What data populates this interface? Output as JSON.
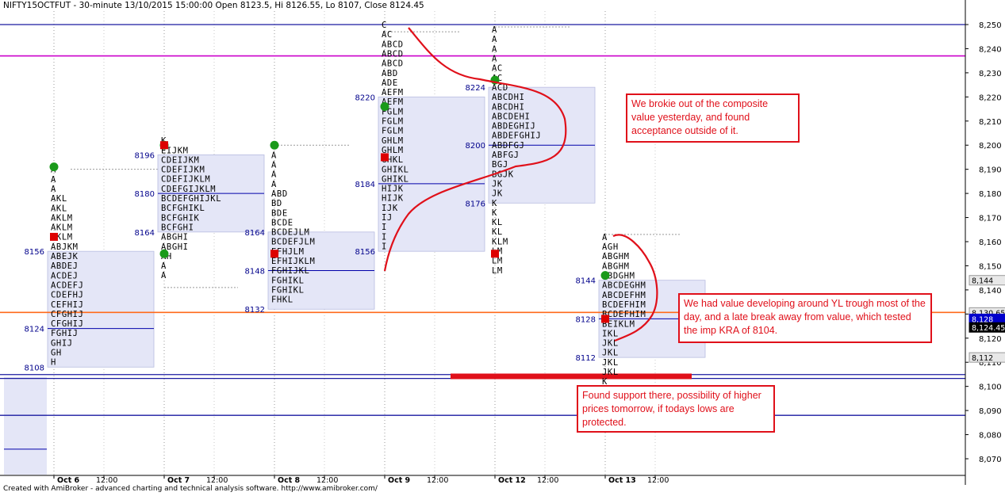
{
  "header": {
    "title": "NIFTY15OCTFUT - 30-minute 13/10/2015 15:00:00 Open 8123.5, Hi 8126.55, Lo 8107, Close 8124.45"
  },
  "footer": {
    "text": "Created with AmiBroker - advanced charting and technical analysis software. http://www.amibroker.com/"
  },
  "notes": [
    {
      "text": "We brokie out of the composite value yesterday, and found acceptance outside of it."
    },
    {
      "text": "We had value developing around YL trough most of the day, and a late break away from value, which tested the imp KRA of 8104."
    },
    {
      "text": "Found support there, possibility of higher prices tomorrow, if todays lows are protected."
    }
  ],
  "colors": {
    "value_area_fill": "#e4e6f7",
    "dark_blue": "#1a1aa0",
    "magenta": "#cc00cc",
    "orange": "#ff6a1a",
    "annotation_red": "#e0101a",
    "poc_blue": "#0000aa",
    "green_dot": "#1a9a1a",
    "red_square": "#dd0000",
    "price_label_text": "#00008b"
  },
  "chart_data": {
    "type": "market_profile",
    "title": "NIFTY15OCTFUT - 30-minute 13/10/2015 15:00:00 Open 8123.5, Hi 8126.55, Lo 8107, Close 8124.45",
    "ylim": [
      8062,
      8254
    ],
    "y_ticks": [
      8070,
      8080,
      8090,
      8100,
      8110,
      8120,
      8130,
      8140,
      8150,
      8160,
      8170,
      8180,
      8190,
      8200,
      8210,
      8220,
      8230,
      8240,
      8250
    ],
    "y_tick_labels": [
      "8,070",
      "8,080",
      "8,090",
      "8,100",
      "8,110",
      "8,120",
      "8,130",
      "8,140",
      "8,150",
      "8,160",
      "8,170",
      "8,180",
      "8,190",
      "8,200",
      "8,210",
      "8,220",
      "8,230",
      "8,240",
      "8,250"
    ],
    "x_labels": [
      "Oct 6",
      "12:00",
      "Oct 7",
      "12:00",
      "Oct 8",
      "12:00",
      "Oct 9",
      "12:00",
      "Oct 12",
      "12:00",
      "Oct 13",
      "12:00"
    ],
    "horizontal_lines": [
      {
        "price": 8250,
        "color": "dark_blue"
      },
      {
        "price": 8237,
        "color": "magenta"
      },
      {
        "price": 8130.65,
        "color": "orange"
      },
      {
        "price": 8104.9,
        "color": "dark_blue"
      },
      {
        "price": 8103.3,
        "color": "dark_blue"
      },
      {
        "price": 8088,
        "color": "dark_blue"
      }
    ],
    "axis_tags": [
      {
        "text": "8,144",
        "price": 8144,
        "style": "gray"
      },
      {
        "text": "8,130.65",
        "price": 8130.65,
        "style": "gray"
      },
      {
        "text": "8,128",
        "price": 8128,
        "style": "blue"
      },
      {
        "text": "8,124.45",
        "price": 8124.45,
        "style": "dark"
      },
      {
        "text": "8,112",
        "price": 8112,
        "style": "gray"
      }
    ],
    "kra_zone": {
      "from": "Oct 9",
      "to": "Oct 13",
      "price": 8104
    },
    "profiles": [
      {
        "day": "Oct 6",
        "top": 8190,
        "letters": [
          "A",
          "A",
          "A",
          "AKL",
          "AKL",
          "AKLM",
          "AKLM",
          "AKLM",
          "ABJKM",
          "ABEJK",
          "ABDEJ",
          "ACDEJ",
          "ACDEFJ",
          "CDEFHJ",
          "CEFHIJ",
          "CFGHIJ",
          "CFGHIJ",
          "FGHIJ",
          "GHIJ",
          "GH",
          "H"
        ],
        "vah": 8156,
        "poc": 8124,
        "val": 8108,
        "open_marker": "A",
        "close_marker": "M",
        "extra_box": [
          8104,
          8070
        ]
      },
      {
        "day": "Oct 7",
        "top": 8202,
        "letters": [
          "K",
          "EIJKM",
          "CDEIJKM",
          "CDEFIJKM",
          "CDEFIJKLM",
          "CDEFGIJKLM",
          "BCDEFGHIJKL",
          "BCFGHIKL",
          "BCFGHIK",
          "BCFGHI",
          "ABGHI",
          "ABGHI",
          "AH",
          "A",
          "A"
        ],
        "vah": 8196,
        "poc": 8180,
        "val": 8164,
        "open_marker": "A",
        "close_marker": "M"
      },
      {
        "day": "Oct 8",
        "top": 8200,
        "letters": [
          "A",
          "A",
          "A",
          "A",
          "A",
          "ABD",
          "BD",
          "BDE",
          "BCDE",
          "BCDEJLM",
          "BCDEFJLM",
          "EFHJLM",
          "EFHIJKLM",
          "FGHIJKL",
          "FGHIKL",
          "FGHIKL",
          "FHKL"
        ],
        "vah": 8164,
        "poc": 8148,
        "val": 8132,
        "open_marker": "A",
        "close_marker": "M"
      },
      {
        "day": "Oct 9",
        "top": 8250,
        "letters": [
          "C",
          "AC",
          "ABCD",
          "ABCD",
          "ABCD",
          "ABD",
          "ADE",
          "AEFM",
          "AEFM",
          "FGLM",
          "FGLM",
          "FGLM",
          "GHLM",
          "GHLM",
          "GHKL",
          "GHIKL",
          "GHIKL",
          "HIJK",
          "HIJK",
          "IJK",
          "IJ",
          "I",
          "I",
          "I"
        ],
        "vah": 8220,
        "poc": 8184,
        "val": 8156,
        "open_marker": "A",
        "close_marker": "M"
      },
      {
        "day": "Oct 12",
        "top": 8248,
        "letters": [
          "A",
          "A",
          "A",
          "A",
          "AC",
          "AC",
          "ACD",
          "ABCDHI",
          "ABCDHI",
          "ABCDEHI",
          "ABDEGHIJ",
          "ABDEFGHIJ",
          "ABDFGJ",
          "ABFGJ",
          "BGJ",
          "BGJK",
          "JK",
          "JK",
          "K",
          "K",
          "KL",
          "KL",
          "KLM",
          "LM",
          "LM",
          "LM"
        ],
        "vah": 8224,
        "poc": 8200,
        "val": 8176,
        "open_marker": "A",
        "close_marker": "M"
      },
      {
        "day": "Oct 13",
        "top": 8162,
        "letters": [
          "A",
          "AGH",
          "ABGHM",
          "ABGHM",
          "ABDGHM",
          "ABCDEGHM",
          "ABCDEFHM",
          "BCDEFHIM",
          "BCDEFHIM",
          "BEIKLM",
          "IKL",
          "JKL",
          "JKL",
          "JKL",
          "JKL",
          "K"
        ],
        "vah": 8144,
        "poc": 8128,
        "val": 8112,
        "open_marker": "A",
        "close_marker": "M"
      }
    ],
    "value_labels": [
      "8156",
      "8124",
      "8108",
      "8196",
      "8180",
      "8164",
      "8164",
      "8148",
      "8132",
      "8220",
      "8184",
      "8156",
      "8224",
      "8200",
      "8176",
      "8144",
      "8128",
      "8112"
    ]
  }
}
